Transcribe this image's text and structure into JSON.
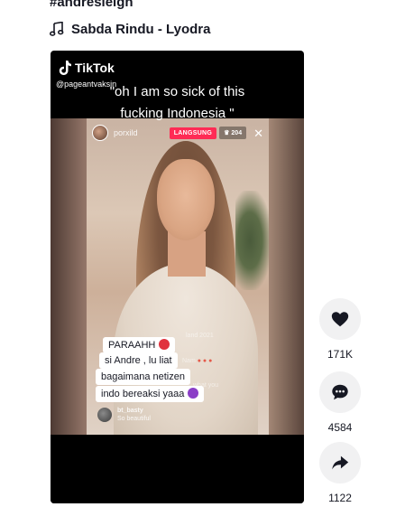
{
  "post": {
    "hashtag": "#andresleigh",
    "music": "Sabda Rindu - Lyodra"
  },
  "video": {
    "brand": "TikTok",
    "handle": "@pageantvaksin",
    "caption_line1": "\"oh I am so sick of this",
    "caption_line2": "fucking Indonesia \"",
    "live": {
      "username": "porxild",
      "live_label": "LANGSUNG",
      "viewers": "204",
      "faded_1": "land 2021",
      "faded_2": "Nam",
      "faded_3": "what you"
    },
    "comments": [
      "PARAAHH",
      "si Andre , lu liat",
      "bagaimana netizen",
      "indo bereaksi yaaa"
    ],
    "chat": {
      "user": "bt_basty",
      "text": "So beautiful"
    }
  },
  "actions": {
    "likes": "171K",
    "comments": "4584",
    "shares": "1122"
  },
  "icons": {
    "music": "music-note-icon",
    "like": "heart-icon",
    "comment": "comment-bubble-icon",
    "share": "share-arrow-icon",
    "close": "close-icon"
  },
  "colors": {
    "live_badge": "#ff2b55",
    "action_bg": "#f1f1f2",
    "text": "#161823"
  }
}
